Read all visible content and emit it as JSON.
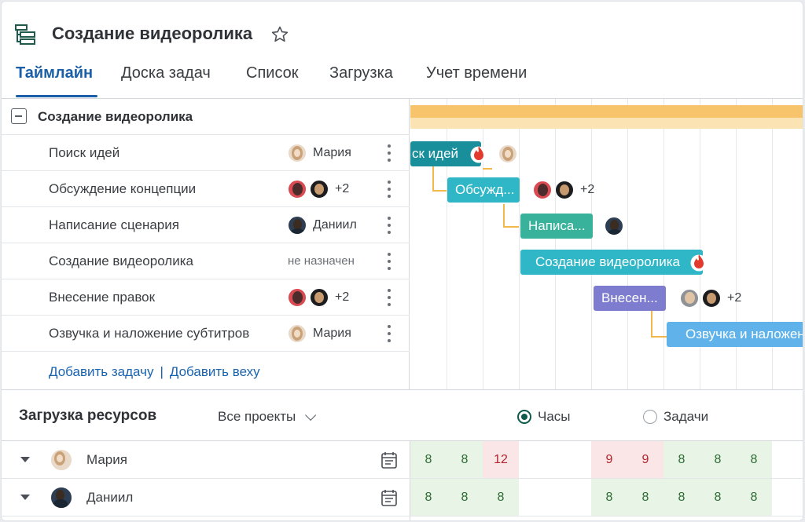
{
  "project": {
    "title": "Создание видеоролика"
  },
  "tabs": [
    {
      "label": "Таймлайн",
      "active": true
    },
    {
      "label": "Доска задач"
    },
    {
      "label": "Список"
    },
    {
      "label": "Загрузка"
    },
    {
      "label": "Учет времени"
    }
  ],
  "group": {
    "title": "Создание видеоролика"
  },
  "tasks": [
    {
      "name": "Поиск идей",
      "assignee": "Мария"
    },
    {
      "name": "Обсуждение концепции",
      "extra": "+2"
    },
    {
      "name": "Написание сценария",
      "assignee": "Даниил"
    },
    {
      "name": "Создание видеоролика",
      "unassigned": "не назначен"
    },
    {
      "name": "Внесение правок",
      "extra": "+2"
    },
    {
      "name": "Озвучка и наложение субтитров",
      "assignee": "Мария"
    }
  ],
  "add_task": "Добавить задачу",
  "add_links_separator": "|",
  "add_milestone": "Добавить веху",
  "gantt": {
    "bars": [
      {
        "label": "ск идей",
        "color": "#1a8f9c"
      },
      {
        "label": "Обсужд...",
        "color": "#2fb7c7",
        "extra": "+2"
      },
      {
        "label": "Написа...",
        "color": "#38b29a"
      },
      {
        "label": "Создание видеоролика",
        "color": "#2fb7c7"
      },
      {
        "label": "Внесен...",
        "color": "#7e7ccf",
        "extra": "+2"
      },
      {
        "label": "Озвучка и наложение субтитров",
        "color": "#5fb2ea"
      }
    ],
    "summary_color": "#f7c46b",
    "connector_color": "#f2b84b"
  },
  "resources": {
    "title": "Загрузка ресурсов",
    "project_filter": "Все проекты",
    "mode_hours": "Часы",
    "mode_tasks": "Задачи",
    "selected_mode": "Часы",
    "people": [
      {
        "name": "Мария",
        "hours": [
          "8",
          "8",
          "12",
          "",
          "",
          "9",
          "9",
          "8",
          "8",
          "8"
        ]
      },
      {
        "name": "Даниил",
        "hours": [
          "8",
          "8",
          "8",
          "",
          "",
          "8",
          "8",
          "8",
          "8",
          "8"
        ]
      }
    ]
  },
  "colors": {
    "accent": "#1a5fa8",
    "overload": "#b0262f",
    "normal_load": "#2d6b33"
  }
}
